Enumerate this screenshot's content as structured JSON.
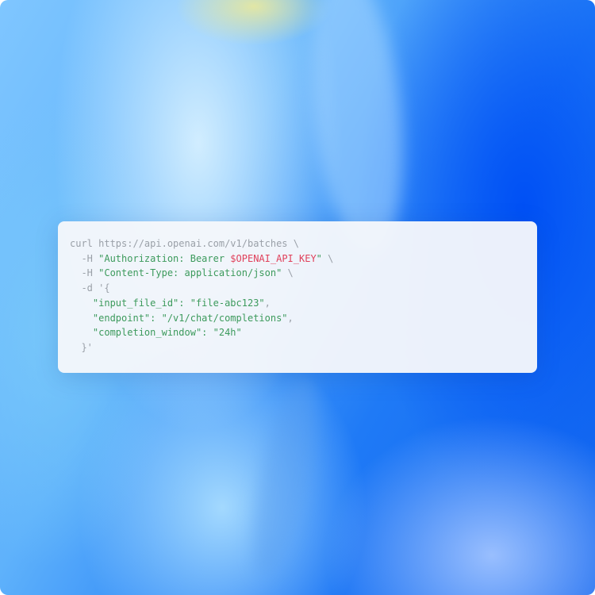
{
  "code": {
    "lines": [
      {
        "seg": [
          "curl https://api.openai.com/v1/batches \\"
        ]
      },
      {
        "seg": [
          "  -H ",
          "\"Authorization: Bearer ",
          "$OPENAI_API_KEY",
          "\"",
          " \\"
        ]
      },
      {
        "seg": [
          "  -H ",
          "\"Content-Type: application/json\"",
          " \\"
        ]
      },
      {
        "seg": [
          "  -d '{"
        ]
      },
      {
        "seg": [
          "    \"input_file_id\": ",
          "\"file-abc123\"",
          ","
        ]
      },
      {
        "seg": [
          "    \"endpoint\": ",
          "\"/v1/chat/completions\"",
          ","
        ]
      },
      {
        "seg": [
          "    \"completion_window\": ",
          "\"24h\""
        ]
      },
      {
        "seg": [
          "  }'"
        ]
      }
    ]
  },
  "colors": {
    "string": "#3c9a5c",
    "variable": "#e0405a",
    "plain": "#9aa0a8",
    "card": "#f5f7fb"
  }
}
